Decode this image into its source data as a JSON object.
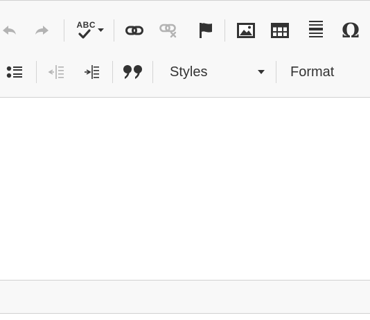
{
  "toolbar": {
    "row1": {
      "undo_icon": "undo-arrow-icon",
      "redo_icon": "redo-arrow-icon",
      "spellcheck_text": "ABC",
      "spellcheck_icon": "checkmark-icon",
      "dropdown_icon": "caret-down-icon",
      "link_icon": "chain-link-icon",
      "unlink_icon": "broken-link-icon",
      "anchor_icon": "flag-icon",
      "image_icon": "image-icon",
      "table_icon": "table-grid-icon",
      "hr_icon": "horizontal-lines-icon",
      "special_char": "Ω"
    },
    "row2": {
      "bulleted_list_icon": "bulleted-list-icon",
      "outdent_icon": "outdent-icon",
      "indent_icon": "indent-icon",
      "blockquote_char": "❞",
      "styles_label": "Styles",
      "styles_dropdown_icon": "caret-down-icon",
      "format_label": "Format"
    }
  },
  "colors": {
    "icon_active": "#333333",
    "icon_disabled": "#b3b3b3",
    "toolbar_bg": "#f8f8f8",
    "border": "#d1d1d1"
  }
}
